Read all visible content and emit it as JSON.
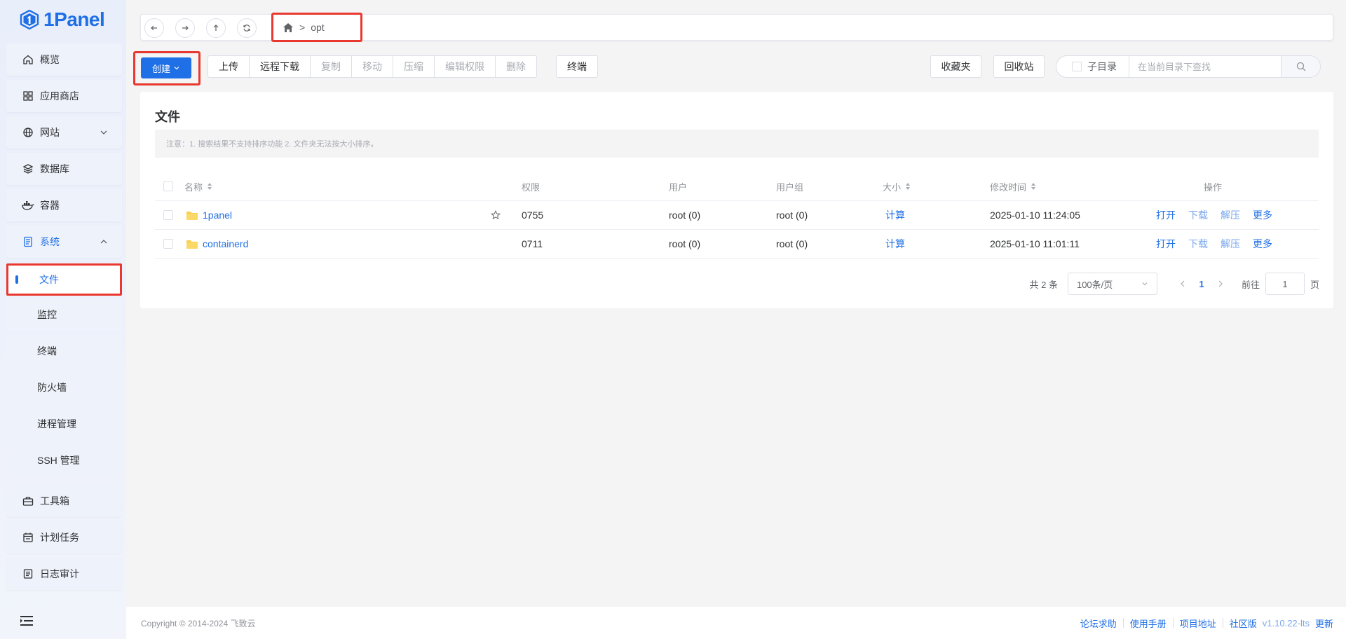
{
  "app": {
    "logo_text": "1Panel"
  },
  "sidebar": {
    "items": [
      {
        "label": "概览",
        "icon": "home-icon"
      },
      {
        "label": "应用商店",
        "icon": "grid-icon"
      },
      {
        "label": "网站",
        "icon": "globe-icon"
      },
      {
        "label": "数据库",
        "icon": "layers-icon"
      },
      {
        "label": "容器",
        "icon": "docker-icon"
      },
      {
        "label": "系统",
        "icon": "server-icon"
      },
      {
        "label": "工具箱",
        "icon": "toolbox-icon"
      },
      {
        "label": "计划任务",
        "icon": "calendar-icon"
      },
      {
        "label": "日志审计",
        "icon": "log-icon"
      }
    ],
    "system_sub": [
      {
        "label": "文件"
      },
      {
        "label": "监控"
      },
      {
        "label": "终端"
      },
      {
        "label": "防火墙"
      },
      {
        "label": "进程管理"
      },
      {
        "label": "SSH 管理"
      }
    ]
  },
  "path": {
    "separator": ">",
    "current": "opt"
  },
  "toolbar": {
    "create": "创建",
    "upload": "上传",
    "remote_download": "远程下载",
    "copy": "复制",
    "move": "移动",
    "compress": "压缩",
    "edit_perm": "编辑权限",
    "delete": "删除",
    "terminal": "终端",
    "favorites": "收藏夹",
    "recycle_bin": "回收站",
    "sub_dir": "子目录",
    "search_placeholder": "在当前目录下查找"
  },
  "card": {
    "title": "文件",
    "notice": "注意：1. 搜索结果不支持排序功能 2. 文件夹无法按大小排序。"
  },
  "table": {
    "headers": {
      "name": "名称",
      "perm": "权限",
      "user": "用户",
      "group": "用户组",
      "size": "大小",
      "mtime": "修改时间",
      "ops": "操作"
    },
    "rows": [
      {
        "name": "1panel",
        "perm": "0755",
        "user": "root (0)",
        "group": "root (0)",
        "size": "计算",
        "mtime": "2025-01-10 11:24:05",
        "open": "打开",
        "download": "下载",
        "extract": "解压",
        "more": "更多"
      },
      {
        "name": "containerd",
        "perm": "0711",
        "user": "root (0)",
        "group": "root (0)",
        "size": "计算",
        "mtime": "2025-01-10 11:01:11",
        "open": "打开",
        "download": "下载",
        "extract": "解压",
        "more": "更多"
      }
    ]
  },
  "pagination": {
    "total": "共 2 条",
    "page_size": "100条/页",
    "current_page": "1",
    "goto_label": "前往",
    "goto_value": "1",
    "page_suffix": "页"
  },
  "footer": {
    "copyright": "Copyright © 2014-2024 飞致云",
    "links": [
      "论坛求助",
      "使用手册",
      "项目地址",
      "社区版"
    ],
    "version": "v1.10.22-lts",
    "update": "更新"
  },
  "colors": {
    "accent": "#1f6fe6",
    "highlight": "#e8382f",
    "folder": "#f8cf4f"
  }
}
